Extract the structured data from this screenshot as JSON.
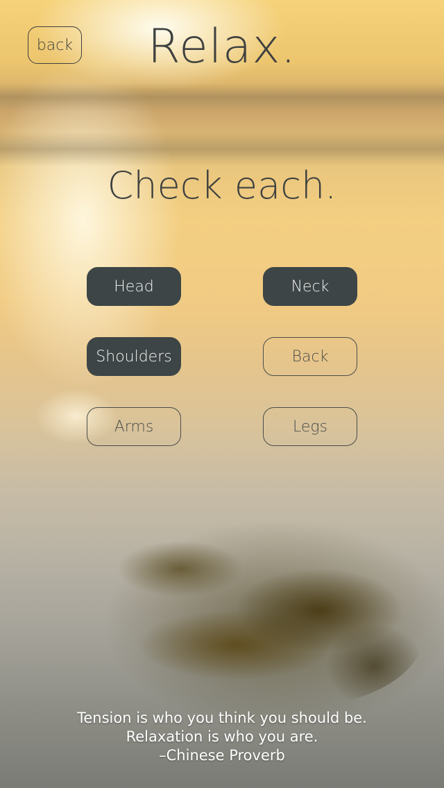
{
  "header": {
    "back_label": "back",
    "title": "Relax."
  },
  "main": {
    "instruction": "Check each.",
    "parts": [
      {
        "label": "Head",
        "checked": true
      },
      {
        "label": "Neck",
        "checked": true
      },
      {
        "label": "Shoulders",
        "checked": true
      },
      {
        "label": "Back",
        "checked": false
      },
      {
        "label": "Arms",
        "checked": false
      },
      {
        "label": "Legs",
        "checked": false
      }
    ]
  },
  "quote": {
    "line1": "Tension is who you think you should be.",
    "line2": "Relaxation is who you are.",
    "attribution": "–Chinese Proverb"
  },
  "colors": {
    "checked_fill": "#3d4546",
    "text_dark": "#3f4140",
    "quote_text": "#ffffff"
  }
}
